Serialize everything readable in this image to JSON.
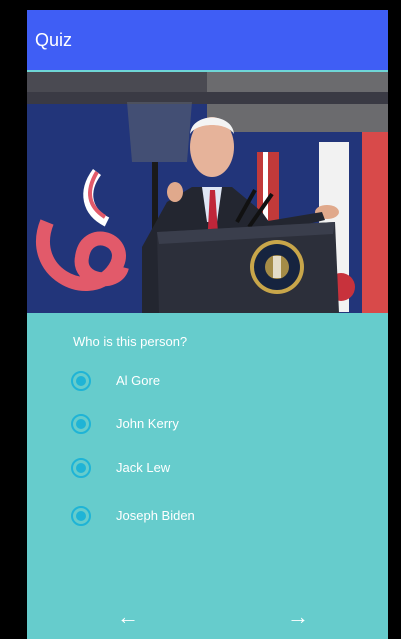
{
  "app": {
    "title": "Quiz"
  },
  "colors": {
    "appbar": "#3F5EF5",
    "background": "#66CCCC",
    "radio": "#1FB4D6",
    "text": "#FFFFFF"
  },
  "quiz": {
    "image_icon": "photo-of-man-speaking-at-podium",
    "question": "Who is this person?",
    "options": [
      {
        "label": "Al Gore",
        "selected": true
      },
      {
        "label": "John Kerry",
        "selected": true
      },
      {
        "label": "Jack Lew",
        "selected": true
      },
      {
        "label": "Joseph Biden",
        "selected": true
      }
    ]
  },
  "navigation": {
    "back_icon": "arrow-left-icon",
    "back_glyph": "←",
    "next_icon": "arrow-right-icon",
    "next_glyph": "→"
  }
}
